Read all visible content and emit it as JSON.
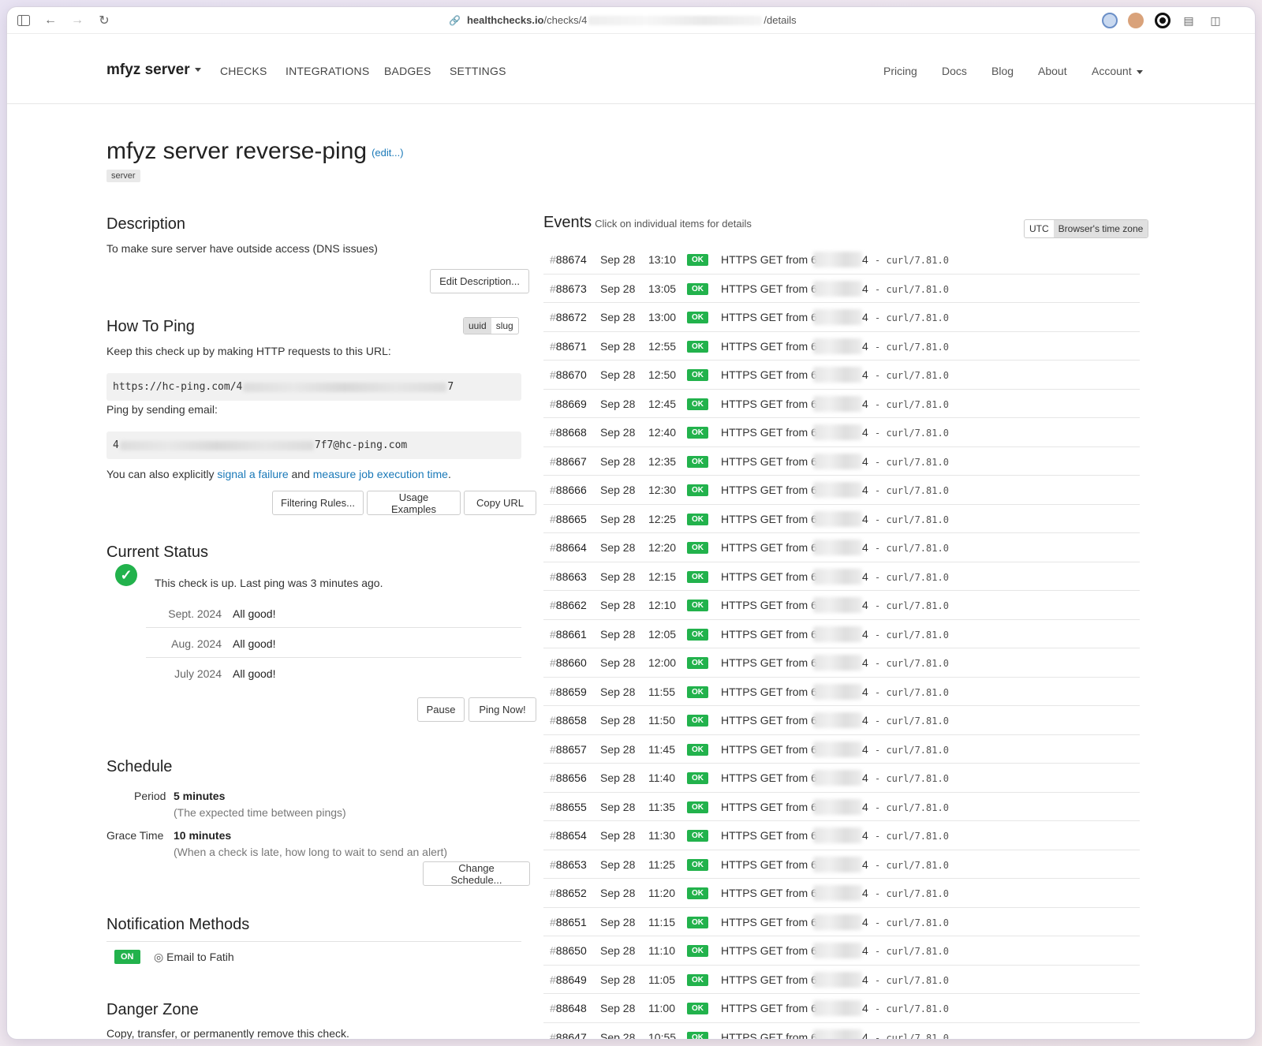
{
  "browser": {
    "url_host": "healthchecks.io",
    "url_path_start": "/checks/4",
    "url_path_end": "/details"
  },
  "nav": {
    "brand": "mfyz server",
    "left": [
      "CHECKS",
      "INTEGRATIONS",
      "BADGES",
      "SETTINGS"
    ],
    "right": [
      "Pricing",
      "Docs",
      "Blog",
      "About",
      "Account"
    ]
  },
  "check": {
    "title": "mfyz server reverse-ping",
    "edit_link": "(edit...)",
    "tag": "server"
  },
  "description": {
    "heading": "Description",
    "text": "To make sure server have outside access (DNS issues)",
    "edit_button": "Edit Description..."
  },
  "how_to_ping": {
    "heading": "How To Ping",
    "toggle": [
      "uuid",
      "slug"
    ],
    "intro": "Keep this check up by making HTTP requests to this URL:",
    "url_start": "https://hc-ping.com/4",
    "url_end": "7",
    "email_intro": "Ping by sending email:",
    "email_start": "4",
    "email_end": "7f7@hc-ping.com",
    "also_text_1": "You can also explicitly",
    "signal_link": "signal a failure",
    "also_text_2": "and",
    "measure_link": "measure job execution time",
    "also_text_3": ".",
    "buttons": [
      "Filtering Rules...",
      "Usage Examples",
      "Copy URL"
    ]
  },
  "current_status": {
    "heading": "Current Status",
    "status_text": "This check is up. Last ping was 3 minutes ago.",
    "history": [
      {
        "month": "Sept. 2024",
        "value": "All good!"
      },
      {
        "month": "Aug. 2024",
        "value": "All good!"
      },
      {
        "month": "July 2024",
        "value": "All good!"
      }
    ],
    "pause_button": "Pause",
    "ping_button": "Ping Now!"
  },
  "schedule": {
    "heading": "Schedule",
    "period_label": "Period",
    "period_value": "5 minutes",
    "period_hint": "(The expected time between pings)",
    "grace_label": "Grace Time",
    "grace_value": "10 minutes",
    "grace_hint": "(When a check is late, how long to wait to send an alert)",
    "change_button": "Change Schedule..."
  },
  "notifications": {
    "heading": "Notification Methods",
    "badge": "ON",
    "method": "Email to Fatih"
  },
  "danger": {
    "heading": "Danger Zone",
    "text": "Copy, transfer, or permanently remove this check."
  },
  "events": {
    "heading": "Events",
    "subtitle": "Click on individual items for details",
    "tz_options": [
      "UTC",
      "Browser's time zone"
    ],
    "desc_prefix": "HTTPS GET from 6",
    "desc_suffix": "4",
    "ua": "- curl/7.81.0",
    "status": "OK",
    "date": "Sep 28",
    "rows": [
      {
        "id": "88674",
        "time": "13:10"
      },
      {
        "id": "88673",
        "time": "13:05"
      },
      {
        "id": "88672",
        "time": "13:00"
      },
      {
        "id": "88671",
        "time": "12:55"
      },
      {
        "id": "88670",
        "time": "12:50"
      },
      {
        "id": "88669",
        "time": "12:45"
      },
      {
        "id": "88668",
        "time": "12:40"
      },
      {
        "id": "88667",
        "time": "12:35"
      },
      {
        "id": "88666",
        "time": "12:30"
      },
      {
        "id": "88665",
        "time": "12:25"
      },
      {
        "id": "88664",
        "time": "12:20"
      },
      {
        "id": "88663",
        "time": "12:15"
      },
      {
        "id": "88662",
        "time": "12:10"
      },
      {
        "id": "88661",
        "time": "12:05"
      },
      {
        "id": "88660",
        "time": "12:00"
      },
      {
        "id": "88659",
        "time": "11:55"
      },
      {
        "id": "88658",
        "time": "11:50"
      },
      {
        "id": "88657",
        "time": "11:45"
      },
      {
        "id": "88656",
        "time": "11:40"
      },
      {
        "id": "88655",
        "time": "11:35"
      },
      {
        "id": "88654",
        "time": "11:30"
      },
      {
        "id": "88653",
        "time": "11:25"
      },
      {
        "id": "88652",
        "time": "11:20"
      },
      {
        "id": "88651",
        "time": "11:15"
      },
      {
        "id": "88650",
        "time": "11:10"
      },
      {
        "id": "88649",
        "time": "11:05"
      },
      {
        "id": "88648",
        "time": "11:00"
      },
      {
        "id": "88647",
        "time": "10:55"
      }
    ]
  }
}
